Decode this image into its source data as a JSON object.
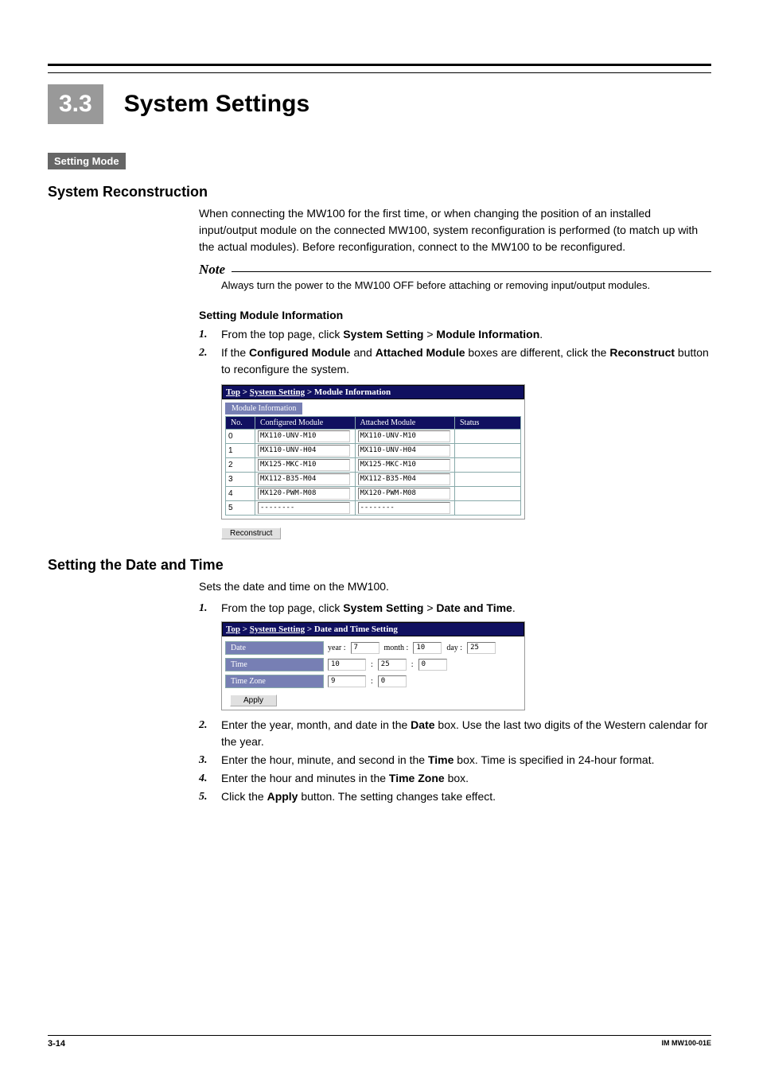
{
  "chapter": {
    "num": "3.3",
    "title": "System Settings"
  },
  "setting_mode": "Setting Mode",
  "sys_reconstruction": {
    "heading": "System Reconstruction",
    "para": "When connecting the MW100 for the first time, or when changing the position of an installed input/output module on the connected MW100, system reconfiguration is performed (to match up with the actual modules). Before reconfiguration, connect to the MW100 to be reconfigured.",
    "note_label": "Note",
    "note_text": "Always turn the power to the MW100 OFF before attaching or removing input/output modules."
  },
  "module_info": {
    "heading": "Setting Module Information",
    "step1_pre": "From the top page, click ",
    "step1_b1": "System Setting",
    "step1_sep": " > ",
    "step1_b2": "Module Information",
    "step1_end": ".",
    "step2_pre": "If the ",
    "step2_b1": "Configured Module",
    "step2_mid": " and ",
    "step2_b2": "Attached Module",
    "step2_post": " boxes are different, click the ",
    "step2_b3": "Reconstruct",
    "step2_end": " button to reconfigure the system."
  },
  "shot1": {
    "crumb_top": "Top",
    "crumb_sys": "System Setting",
    "crumb_last": "Module Information",
    "tab": "Module Information",
    "th_no": "No.",
    "th_conf": "Configured Module",
    "th_att": "Attached Module",
    "th_status": "Status",
    "rows": [
      {
        "no": "0",
        "conf": "MX110-UNV-M10",
        "att": "MX110-UNV-M10"
      },
      {
        "no": "1",
        "conf": "MX110-UNV-H04",
        "att": "MX110-UNV-H04"
      },
      {
        "no": "2",
        "conf": "MX125-MKC-M10",
        "att": "MX125-MKC-M10"
      },
      {
        "no": "3",
        "conf": "MX112-B35-M04",
        "att": "MX112-B35-M04"
      },
      {
        "no": "4",
        "conf": "MX120-PWM-M08",
        "att": "MX120-PWM-M08"
      },
      {
        "no": "5",
        "conf": "--------",
        "att": "--------"
      }
    ],
    "reconstruct": "Reconstruct"
  },
  "datetime": {
    "heading": "Setting the Date and Time",
    "para": "Sets the date and time on the MW100.",
    "step1_pre": "From the top page, click ",
    "step1_b1": "System Setting",
    "step1_sep": " > ",
    "step1_b2": "Date and Time",
    "step1_end": ".",
    "step2_pre": "Enter the year, month, and date in the ",
    "step2_b1": "Date",
    "step2_post": " box. Use the last two digits of the Western calendar for the year.",
    "step3_pre": "Enter the hour, minute, and second in the ",
    "step3_b1": "Time",
    "step3_post": " box. Time is specified in 24-hour format.",
    "step4_pre": "Enter the hour and minutes in the ",
    "step4_b1": "Time Zone",
    "step4_post": " box.",
    "step5_pre": "Click the ",
    "step5_b1": "Apply",
    "step5_post": " button. The setting changes take effect."
  },
  "shot2": {
    "crumb_top": "Top",
    "crumb_sys": "System Setting",
    "crumb_last": "Date and Time Setting",
    "date_label": "Date",
    "year_l": "year :",
    "year_v": "7",
    "month_l": "month :",
    "month_v": "10",
    "day_l": "day :",
    "day_v": "25",
    "time_label": "Time",
    "time_h": "10",
    "time_m": "25",
    "time_s": "0",
    "tz_label": "Time Zone",
    "tz_h": "9",
    "tz_m": "0",
    "apply": "Apply"
  },
  "footer": {
    "page": "3-14",
    "doc": "IM MW100-01E"
  }
}
